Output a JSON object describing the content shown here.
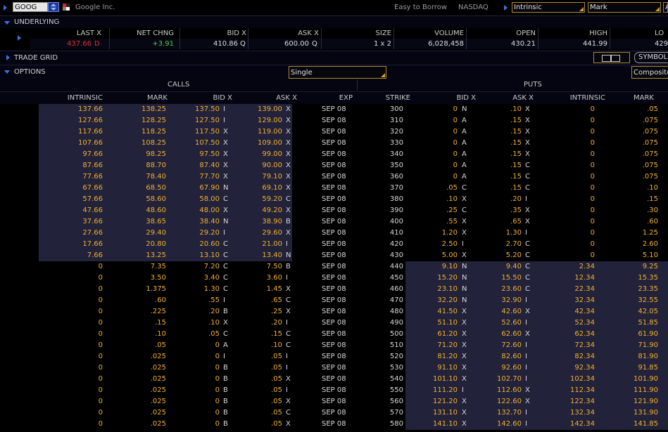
{
  "topbar": {
    "symbol": "GOOG",
    "company": "Google Inc.",
    "borrow": "Easy to Borrow",
    "exchange": "NASDAQ",
    "field1": "Intrinsic",
    "field2": "Mark",
    "field3": "A"
  },
  "underlying": {
    "label": "UNDERLYING",
    "headers": [
      "LAST X",
      "NET CHNG",
      "BID X",
      "ASK X",
      "SIZE",
      "VOLUME",
      "OPEN",
      "HIGH",
      "LO"
    ],
    "last": "437.66",
    "last_ex": "D",
    "net_chng": "+3.91",
    "bid": "410.86",
    "bid_ex": "Q",
    "ask": "600.00",
    "ask_ex": "Q",
    "size": "1 x 2",
    "volume": "6,028,458",
    "open": "430.21",
    "high": "441.99",
    "low": "429"
  },
  "tradegrid": {
    "label": "TRADE GRID",
    "symbol_btn": "SYMBOL"
  },
  "options": {
    "label": "OPTIONS",
    "spread": "Single",
    "exchange_select": "Composite",
    "calls_label": "CALLS",
    "puts_label": "PUTS",
    "columns": [
      "INTRINSIC",
      "MARK",
      "BID X",
      "ASK X",
      "EXP",
      "STRIKE",
      "BID X",
      "ASK X",
      "INTRINSIC",
      "MARK"
    ]
  },
  "chain": [
    {
      "ci": "137.66",
      "cm": "138.25",
      "cb": "137.50",
      "cbx": "I",
      "ca": "139.00",
      "cax": "X",
      "exp": "SEP 08",
      "k": "300",
      "pb": "0",
      "pbx": "N",
      "pa": ".10",
      "pax": "X",
      "pi": "0",
      "pm": ".05"
    },
    {
      "ci": "127.66",
      "cm": "128.25",
      "cb": "127.50",
      "cbx": "I",
      "ca": "129.00",
      "cax": "X",
      "exp": "SEP 08",
      "k": "310",
      "pb": "0",
      "pbx": "A",
      "pa": ".15",
      "pax": "X",
      "pi": "0",
      "pm": ".075"
    },
    {
      "ci": "117.66",
      "cm": "118.25",
      "cb": "117.50",
      "cbx": "X",
      "ca": "119.00",
      "cax": "X",
      "exp": "SEP 08",
      "k": "320",
      "pb": "0",
      "pbx": "A",
      "pa": ".15",
      "pax": "X",
      "pi": "0",
      "pm": ".075"
    },
    {
      "ci": "107.66",
      "cm": "108.25",
      "cb": "107.50",
      "cbx": "X",
      "ca": "109.00",
      "cax": "X",
      "exp": "SEP 08",
      "k": "330",
      "pb": "0",
      "pbx": "A",
      "pa": ".15",
      "pax": "X",
      "pi": "0",
      "pm": ".075"
    },
    {
      "ci": "97.66",
      "cm": "98.25",
      "cb": "97.50",
      "cbx": "X",
      "ca": "99.00",
      "cax": "X",
      "exp": "SEP 08",
      "k": "340",
      "pb": "0",
      "pbx": "A",
      "pa": ".15",
      "pax": "X",
      "pi": "0",
      "pm": ".075"
    },
    {
      "ci": "87.66",
      "cm": "88.70",
      "cb": "87.40",
      "cbx": "X",
      "ca": "90.00",
      "cax": "X",
      "exp": "SEP 08",
      "k": "350",
      "pb": "0",
      "pbx": "A",
      "pa": ".15",
      "pax": "C",
      "pi": "0",
      "pm": ".075"
    },
    {
      "ci": "77.66",
      "cm": "78.40",
      "cb": "77.70",
      "cbx": "X",
      "ca": "79.10",
      "cax": "X",
      "exp": "SEP 08",
      "k": "360",
      "pb": "0",
      "pbx": "A",
      "pa": ".15",
      "pax": "C",
      "pi": "0",
      "pm": ".075"
    },
    {
      "ci": "67.66",
      "cm": "68.50",
      "cb": "67.90",
      "cbx": "N",
      "ca": "69.10",
      "cax": "X",
      "exp": "SEP 08",
      "k": "370",
      "pb": ".05",
      "pbx": "C",
      "pa": ".15",
      "pax": "C",
      "pi": "0",
      "pm": ".10"
    },
    {
      "ci": "57.66",
      "cm": "58.60",
      "cb": "58.00",
      "cbx": "C",
      "ca": "59.20",
      "cax": "C",
      "exp": "SEP 08",
      "k": "380",
      "pb": ".10",
      "pbx": "X",
      "pa": ".20",
      "pax": "I",
      "pi": "0",
      "pm": ".15"
    },
    {
      "ci": "47.66",
      "cm": "48.60",
      "cb": "48.00",
      "cbx": "X",
      "ca": "49.20",
      "cax": "X",
      "exp": "SEP 08",
      "k": "390",
      "pb": ".25",
      "pbx": "C",
      "pa": ".35",
      "pax": "X",
      "pi": "0",
      "pm": ".30"
    },
    {
      "ci": "37.66",
      "cm": "38.65",
      "cb": "38.40",
      "cbx": "N",
      "ca": "38.90",
      "cax": "B",
      "exp": "SEP 08",
      "k": "400",
      "pb": ".55",
      "pbx": "X",
      "pa": ".65",
      "pax": "X",
      "pi": "0",
      "pm": ".60"
    },
    {
      "ci": "27.66",
      "cm": "29.40",
      "cb": "29.20",
      "cbx": "I",
      "ca": "29.60",
      "cax": "X",
      "exp": "SEP 08",
      "k": "410",
      "pb": "1.20",
      "pbx": "X",
      "pa": "1.30",
      "pax": "I",
      "pi": "0",
      "pm": "1.25"
    },
    {
      "ci": "17.66",
      "cm": "20.80",
      "cb": "20.60",
      "cbx": "C",
      "ca": "21.00",
      "cax": "I",
      "exp": "SEP 08",
      "k": "420",
      "pb": "2.50",
      "pbx": "I",
      "pa": "2.70",
      "pax": "C",
      "pi": "0",
      "pm": "2.60"
    },
    {
      "ci": "7.66",
      "cm": "13.25",
      "cb": "13.10",
      "cbx": "C",
      "ca": "13.40",
      "cax": "N",
      "exp": "SEP 08",
      "k": "430",
      "pb": "5.00",
      "pbx": "X",
      "pa": "5.20",
      "pax": "C",
      "pi": "0",
      "pm": "5.10"
    },
    {
      "ci": "0",
      "cm": "7.35",
      "cb": "7.20",
      "cbx": "C",
      "ca": "7.50",
      "cax": "B",
      "exp": "SEP 08",
      "k": "440",
      "pb": "9.10",
      "pbx": "N",
      "pa": "9.40",
      "pax": "C",
      "pi": "2.34",
      "pm": "9.25"
    },
    {
      "ci": "0",
      "cm": "3.50",
      "cb": "3.40",
      "cbx": "C",
      "ca": "3.60",
      "cax": "I",
      "exp": "SEP 08",
      "k": "450",
      "pb": "15.20",
      "pbx": "N",
      "pa": "15.50",
      "pax": "C",
      "pi": "12.34",
      "pm": "15.35"
    },
    {
      "ci": "0",
      "cm": "1.375",
      "cb": "1.30",
      "cbx": "C",
      "ca": "1.45",
      "cax": "X",
      "exp": "SEP 08",
      "k": "460",
      "pb": "23.10",
      "pbx": "N",
      "pa": "23.60",
      "pax": "C",
      "pi": "22.34",
      "pm": "23.35"
    },
    {
      "ci": "0",
      "cm": ".60",
      "cb": ".55",
      "cbx": "I",
      "ca": ".65",
      "cax": "C",
      "exp": "SEP 08",
      "k": "470",
      "pb": "32.20",
      "pbx": "N",
      "pa": "32.90",
      "pax": "I",
      "pi": "32.34",
      "pm": "32.55"
    },
    {
      "ci": "0",
      "cm": ".225",
      "cb": ".20",
      "cbx": "B",
      "ca": ".25",
      "cax": "X",
      "exp": "SEP 08",
      "k": "480",
      "pb": "41.50",
      "pbx": "X",
      "pa": "42.60",
      "pax": "X",
      "pi": "42.34",
      "pm": "42.05"
    },
    {
      "ci": "0",
      "cm": ".15",
      "cb": ".10",
      "cbx": "X",
      "ca": ".20",
      "cax": "I",
      "exp": "SEP 08",
      "k": "490",
      "pb": "51.10",
      "pbx": "X",
      "pa": "52.60",
      "pax": "I",
      "pi": "52.34",
      "pm": "51.85"
    },
    {
      "ci": "0",
      "cm": ".10",
      "cb": ".05",
      "cbx": "C",
      "ca": ".15",
      "cax": "C",
      "exp": "SEP 08",
      "k": "500",
      "pb": "61.20",
      "pbx": "X",
      "pa": "62.60",
      "pax": "X",
      "pi": "62.34",
      "pm": "61.90"
    },
    {
      "ci": "0",
      "cm": ".05",
      "cb": "0",
      "cbx": "A",
      "ca": ".10",
      "cax": "C",
      "exp": "SEP 08",
      "k": "510",
      "pb": "71.20",
      "pbx": "X",
      "pa": "72.60",
      "pax": "I",
      "pi": "72.34",
      "pm": "71.90"
    },
    {
      "ci": "0",
      "cm": ".025",
      "cb": "0",
      "cbx": "I",
      "ca": ".05",
      "cax": "I",
      "exp": "SEP 08",
      "k": "520",
      "pb": "81.20",
      "pbx": "X",
      "pa": "82.60",
      "pax": "I",
      "pi": "82.34",
      "pm": "81.90"
    },
    {
      "ci": "0",
      "cm": ".025",
      "cb": "0",
      "cbx": "B",
      "ca": ".05",
      "cax": "I",
      "exp": "SEP 08",
      "k": "530",
      "pb": "91.10",
      "pbx": "X",
      "pa": "92.60",
      "pax": "I",
      "pi": "92.34",
      "pm": "91.85"
    },
    {
      "ci": "0",
      "cm": ".025",
      "cb": "0",
      "cbx": "B",
      "ca": ".05",
      "cax": "X",
      "exp": "SEP 08",
      "k": "540",
      "pb": "101.10",
      "pbx": "X",
      "pa": "102.70",
      "pax": "I",
      "pi": "102.34",
      "pm": "101.90"
    },
    {
      "ci": "0",
      "cm": ".025",
      "cb": "0",
      "cbx": "B",
      "ca": ".05",
      "cax": "I",
      "exp": "SEP 08",
      "k": "550",
      "pb": "111.20",
      "pbx": "I",
      "pa": "112.60",
      "pax": "X",
      "pi": "112.34",
      "pm": "111.90"
    },
    {
      "ci": "0",
      "cm": ".025",
      "cb": "0",
      "cbx": "B",
      "ca": ".05",
      "cax": "X",
      "exp": "SEP 08",
      "k": "560",
      "pb": "121.20",
      "pbx": "X",
      "pa": "122.60",
      "pax": "X",
      "pi": "122.34",
      "pm": "121.90"
    },
    {
      "ci": "0",
      "cm": ".025",
      "cb": "0",
      "cbx": "B",
      "ca": ".05",
      "cax": "C",
      "exp": "SEP 08",
      "k": "570",
      "pb": "131.10",
      "pbx": "X",
      "pa": "132.70",
      "pax": "I",
      "pi": "132.34",
      "pm": "131.90"
    },
    {
      "ci": "0",
      "cm": ".025",
      "cb": "0",
      "cbx": "B",
      "ca": ".05",
      "cax": "X",
      "exp": "SEP 08",
      "k": "580",
      "pb": "141.10",
      "pbx": "X",
      "pa": "142.60",
      "pax": "I",
      "pi": "142.34",
      "pm": "141.85"
    }
  ],
  "colors": {
    "accent_blue": "#3e6fe0",
    "value_orange": "#f0b030",
    "last_red": "#e03030",
    "change_green": "#3ed23e",
    "itm_shade": "#22223a",
    "dropdown_border": "#d4a32c"
  }
}
